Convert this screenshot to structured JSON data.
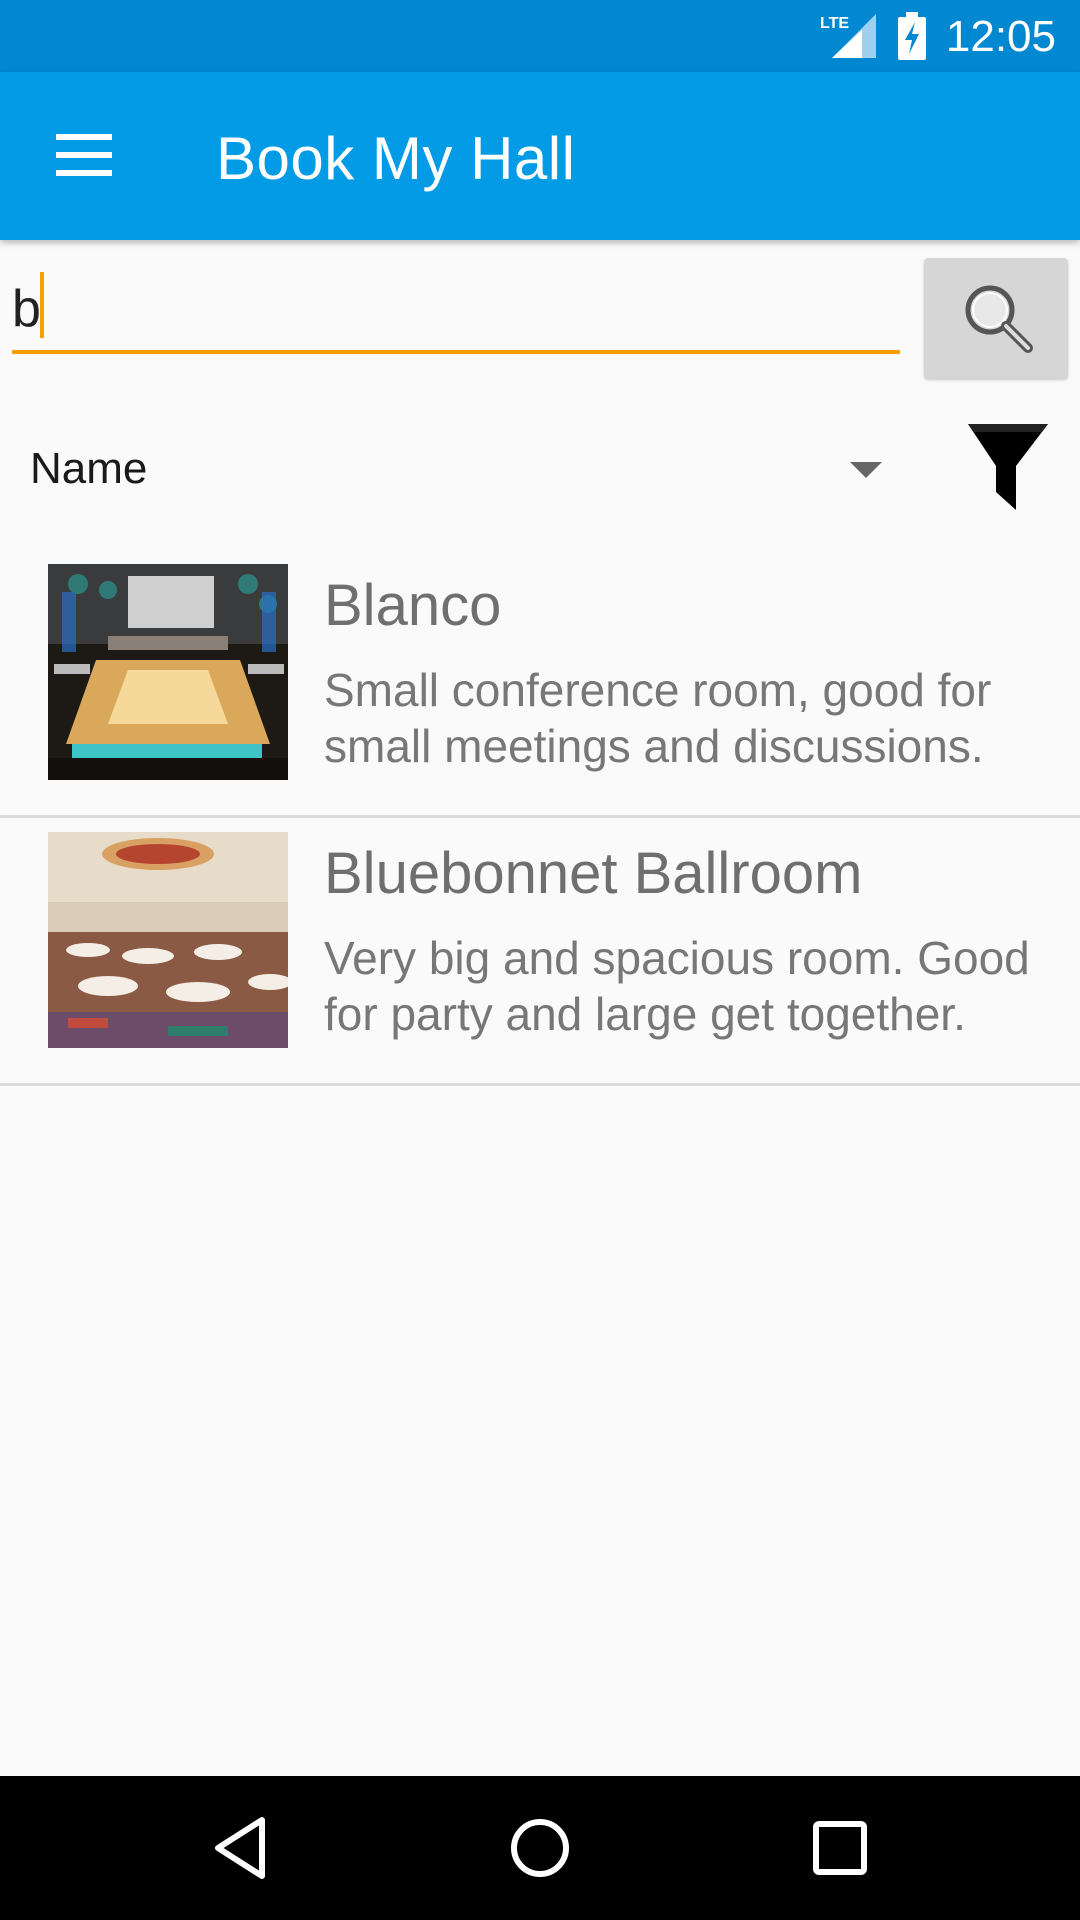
{
  "status_bar": {
    "time": "12:05",
    "network_icon": "lte-signal-icon",
    "battery_icon": "battery-charging-icon"
  },
  "app_bar": {
    "title": "Book My Hall",
    "menu_icon": "hamburger-menu-icon"
  },
  "search": {
    "value": "b",
    "button_icon": "search-icon",
    "accent_color": "#f9a000"
  },
  "sort": {
    "selected": "Name",
    "filter_icon": "filter-icon"
  },
  "halls": [
    {
      "name": "Blanco",
      "description": "Small conference room, good for small meetings and discussions."
    },
    {
      "name": "Bluebonnet Ballroom",
      "description": "Very big and spacious room. Good for party and large get together."
    }
  ],
  "nav": {
    "back_icon": "back-icon",
    "home_icon": "home-icon",
    "recents_icon": "recents-icon"
  },
  "colors": {
    "status_bar": "#0288d1",
    "app_bar": "#039be5",
    "background": "#fafafa"
  }
}
